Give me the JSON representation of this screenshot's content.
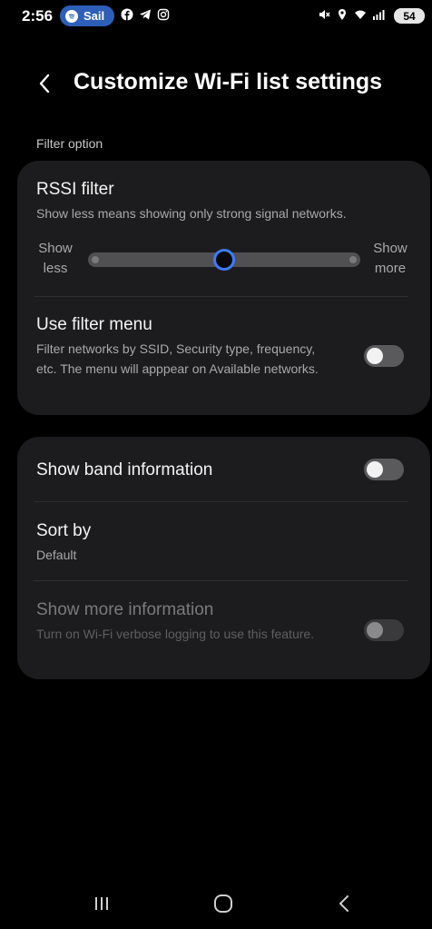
{
  "status_bar": {
    "time": "2:56",
    "spotify_label": "Sail",
    "battery": "54",
    "left_icons": [
      "facebook-icon",
      "telegram-icon",
      "instagram-icon"
    ],
    "right_icons": [
      "mute-icon",
      "location-icon",
      "wifi-icon",
      "signal-icon"
    ]
  },
  "header": {
    "title": "Customize Wi-Fi list settings"
  },
  "section_label": "Filter option",
  "rssi": {
    "title": "RSSI filter",
    "subtitle": "Show less means showing only strong signal networks.",
    "left_label": "Show less",
    "right_label": "Show more",
    "value_fraction": 0.5
  },
  "filter_menu": {
    "title": "Use filter menu",
    "subtitle": "Filter networks by SSID, Security type, frequency, etc. The menu will apppear on Available networks.",
    "enabled": false
  },
  "band_info": {
    "title": "Show band information",
    "enabled": false
  },
  "sort_by": {
    "title": "Sort by",
    "value": "Default"
  },
  "more_info": {
    "title": "Show more information",
    "subtitle": "Turn on Wi-Fi verbose logging to use this feature.",
    "enabled": false,
    "disabled": true
  },
  "colors": {
    "background": "#000000",
    "card": "#1c1c1e",
    "accent": "#3e7bff",
    "spotify_pill": "#2d5fb8"
  },
  "nav": {
    "icons": [
      "recent-apps-icon",
      "home-icon",
      "back-icon"
    ]
  }
}
